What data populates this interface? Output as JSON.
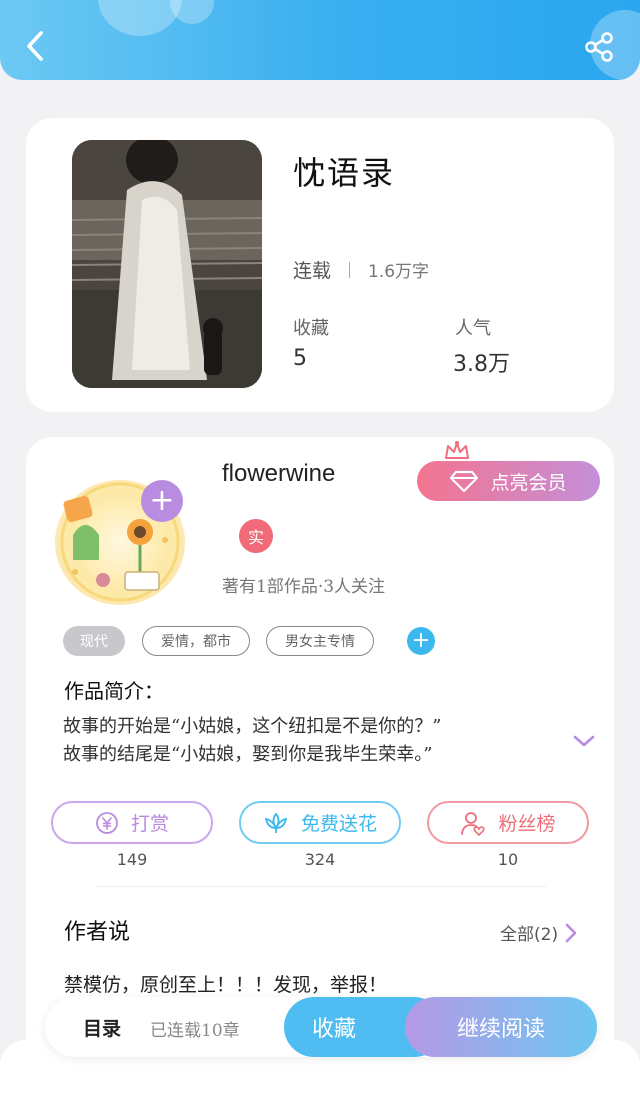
{
  "header": {
    "back_icon": "chevron-left-icon",
    "share_icon": "share-icon"
  },
  "book": {
    "title": "忱语录",
    "status": "连载",
    "word_count": "1.6万字",
    "favorites_label": "收藏",
    "favorites_value": "5",
    "popularity_label": "人气",
    "popularity_value": "3.8万"
  },
  "author": {
    "name": "flowerwine",
    "vip_label": "点亮会员",
    "real_badge": "实",
    "stats": "著有1部作品·3人关注"
  },
  "tags": [
    "现代",
    "爱情，都市",
    "男女主专情"
  ],
  "intro": {
    "heading": "作品简介：",
    "lines": [
      "故事的开始是“小姑娘，这个纽扣是不是你的？”",
      "故事的结尾是“小姑娘，娶到你是我毕生荣幸。”"
    ]
  },
  "actions": [
    {
      "label": "打赏",
      "count": "149",
      "color": "#b98ae0"
    },
    {
      "label": "免费送花",
      "count": "324",
      "color": "#3bb9ee"
    },
    {
      "label": "粉丝榜",
      "count": "10",
      "color": "#ef6f78"
    }
  ],
  "author_says": {
    "heading": "作者说",
    "all_label": "全部(2)",
    "text": "禁模仿，原创至上！！！发现，举报！"
  },
  "bottom_bar": {
    "toc_label": "目录",
    "chapter_count": "已连载10章",
    "favorite_button": "收藏",
    "continue_button": "继续阅读"
  }
}
